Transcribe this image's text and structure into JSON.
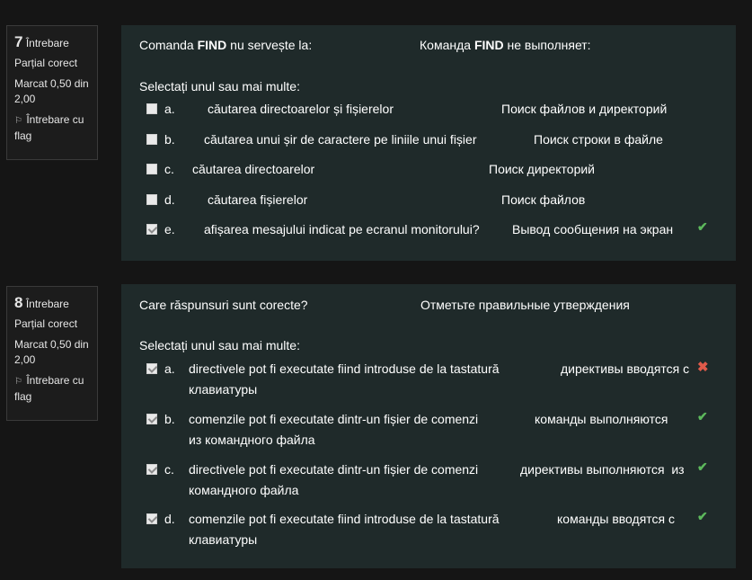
{
  "q7": {
    "number": "7",
    "word": "Întrebare",
    "state": "Parțial corect",
    "mark": "Marcat 0,50 din 2,00",
    "flag_label": "Întrebare cu flag",
    "text_ro_pre": "Comanda ",
    "text_ro_bold": "FIND",
    "text_ro_post": " nu servește la:",
    "text_ru_pre": "Команда ",
    "text_ru_bold": "FIND",
    "text_ru_post": " не выполняет:",
    "prompt": "Selectați unul sau mai multe:",
    "options": [
      {
        "letter": "a.",
        "ro": "căutarea directoarelor și fișierelor",
        "ru": "Поиск файлов и директорий",
        "checked": false,
        "mark": ""
      },
      {
        "letter": "b.",
        "ro": "căutarea unui șir de caractere pe liniile unui fișier",
        "ru": "Поиск строки в файле",
        "checked": false,
        "mark": ""
      },
      {
        "letter": "c.",
        "ro": "căutarea directoarelor",
        "ru": "Поиск директорий",
        "checked": false,
        "mark": ""
      },
      {
        "letter": "d.",
        "ro": "căutarea fișierelor",
        "ru": "Поиск файлов",
        "checked": false,
        "mark": ""
      },
      {
        "letter": "e.",
        "ro": "afișarea mesajului indicat pe ecranul monitorului?",
        "ru": "Вывод сообщения на экран",
        "checked": true,
        "mark": "✔"
      }
    ]
  },
  "q8": {
    "number": "8",
    "word": "Întrebare",
    "state": "Parțial corect",
    "mark": "Marcat 0,50 din 2,00",
    "flag_label": "Întrebare cu flag",
    "text_ro": "Care răspunsuri sunt corecte?",
    "text_ru": "Отметьте правильные утверждения",
    "prompt": "Selectați unul sau mai multe:",
    "options": [
      {
        "letter": "a.",
        "ro": "directivele pot fi executate fiind introduse de la tastatură",
        "ru1": "директивы вводятся с",
        "ru2": "клавиатуры",
        "checked": true,
        "mark": "✖"
      },
      {
        "letter": "b.",
        "ro": "comenzile pot fi executate dintr-un fișier de comenzi",
        "ru1": "команды выполняются",
        "ru2": "из командного файла",
        "checked": true,
        "mark": "✔"
      },
      {
        "letter": "c.",
        "ro": "directivele pot fi executate dintr-un fișier de comenzi",
        "ru1": "директивы выполняются  из",
        "ru2": "командного файла",
        "checked": true,
        "mark": "✔"
      },
      {
        "letter": "d.",
        "ro": "comenzile pot fi executate fiind introduse de la tastatură",
        "ru1": "команды вводятся с",
        "ru2": "клавиатуры",
        "checked": true,
        "mark": "✔"
      }
    ]
  },
  "colors": {
    "background": "#151515",
    "panel": "#1f2a2a",
    "correct": "#5cb85c",
    "incorrect": "#e05a4a"
  }
}
